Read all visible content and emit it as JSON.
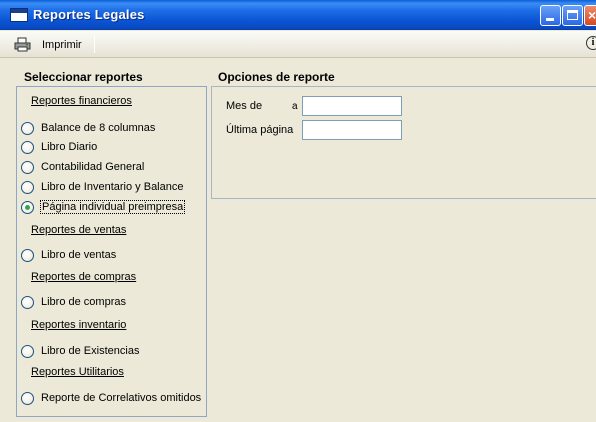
{
  "window": {
    "title": "Reportes Legales"
  },
  "toolbar": {
    "print_label": "Imprimir",
    "info_icon": "info-icon"
  },
  "left": {
    "title": "Seleccionar reportes",
    "groups": [
      {
        "label": "Reportes financieros"
      },
      {
        "label": "Reportes de ventas"
      },
      {
        "label": "Reportes de compras"
      },
      {
        "label": "Reportes inventario"
      },
      {
        "label": "Reportes Utilitarios"
      }
    ],
    "options": [
      {
        "label": "Balance de 8 columnas",
        "checked": false
      },
      {
        "label": "Libro Diario",
        "checked": false
      },
      {
        "label": "Contabilidad General",
        "checked": false
      },
      {
        "label": "Libro de Inventario y Balance",
        "checked": false
      },
      {
        "label": "Página individual preimpresa",
        "checked": true
      },
      {
        "label": "Libro de ventas",
        "checked": false
      },
      {
        "label": "Libro de compras",
        "checked": false
      },
      {
        "label": "Libro de Existencias",
        "checked": false
      },
      {
        "label": "Reporte de Correlativos omitidos",
        "checked": false
      }
    ]
  },
  "right": {
    "title": "Opciones de reporte",
    "fields": [
      {
        "label": "Mes de",
        "extra": "a",
        "value": ""
      },
      {
        "label": "Última página",
        "value": ""
      }
    ]
  }
}
